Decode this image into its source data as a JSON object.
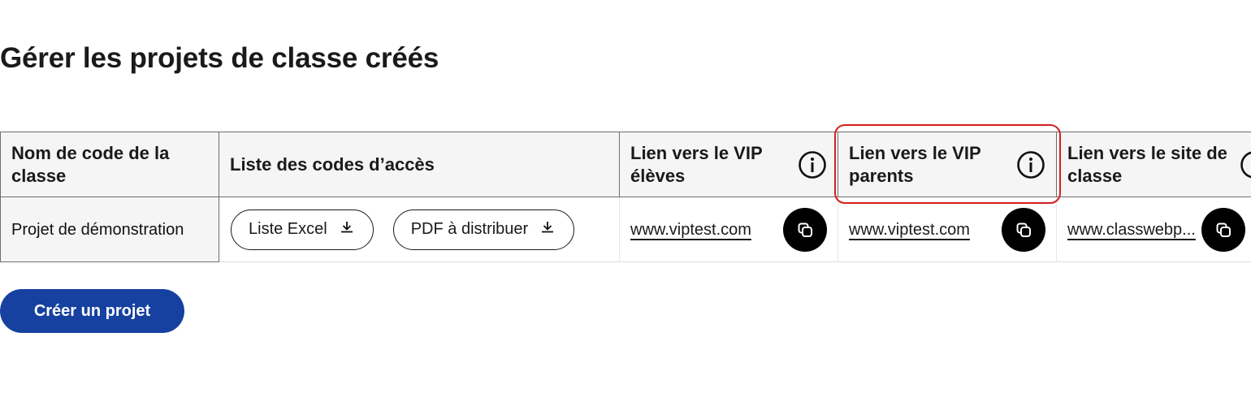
{
  "page": {
    "title": "Gérer les projets de classe créés"
  },
  "table": {
    "headers": {
      "name": "Nom de code de la classe",
      "codes": "Liste des codes d’accès",
      "vip_students": "Lien vers le VIP élèves",
      "vip_parents": "Lien vers le VIP parents",
      "class_site": "Lien vers le site de classe"
    },
    "rows": [
      {
        "name": "Projet de démonstration",
        "excel_button": "Liste Excel",
        "pdf_button": "PDF à distribuer",
        "vip_students_link": "www.viptest.com",
        "vip_parents_link": "www.viptest.com",
        "class_site_link": "www.classwebp..."
      }
    ]
  },
  "actions": {
    "create_project": "Créer un projet"
  },
  "icons": {
    "info": "info-icon",
    "download": "download-icon",
    "copy": "copy-icon"
  },
  "colors": {
    "primary_button": "#1641a0",
    "highlight": "#d41f1f",
    "header_bg": "#f5f5f5"
  }
}
